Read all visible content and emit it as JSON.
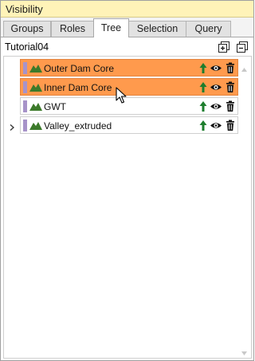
{
  "panel": {
    "title": "Visibility"
  },
  "tabs": [
    {
      "label": "Groups",
      "active": false
    },
    {
      "label": "Roles",
      "active": false
    },
    {
      "label": "Tree",
      "active": true
    },
    {
      "label": "Selection",
      "active": false
    },
    {
      "label": "Query",
      "active": false
    }
  ],
  "tree": {
    "root": "Tutorial04",
    "header_icons": [
      "expand-all-icon",
      "collapse-all-icon"
    ],
    "items": [
      {
        "label": "Outer Dam Core",
        "selected": true,
        "expandable": false
      },
      {
        "label": "Inner Dam Core",
        "selected": true,
        "expandable": false
      },
      {
        "label": "GWT",
        "selected": false,
        "expandable": false
      },
      {
        "label": "Valley_extruded",
        "selected": false,
        "expandable": true
      }
    ],
    "row_icons": [
      "mountain-icon",
      "up-arrow-icon",
      "eye-icon",
      "trash-icon"
    ]
  },
  "colors": {
    "title_bar": "#fff3b8",
    "selection": "#ff9a4d",
    "swatch": "#a793c9",
    "mountain": "#3c7a2a",
    "arrow": "#1d7d2d"
  }
}
